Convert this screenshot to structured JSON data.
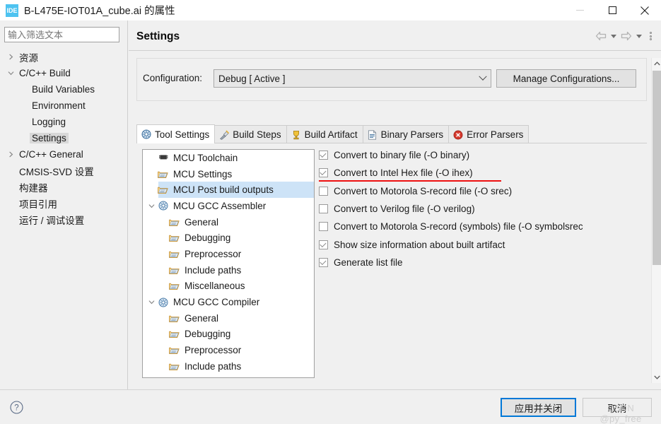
{
  "window": {
    "title": "B-L475E-IOT01A_cube.ai 的属性",
    "app_icon_text": "IDE",
    "controls": [
      {
        "name": "minimize",
        "glyph": "minimize-icon"
      },
      {
        "name": "maximize",
        "glyph": "maximize-icon"
      },
      {
        "name": "close",
        "glyph": "close-icon"
      }
    ]
  },
  "sidebar": {
    "filter_placeholder": "输入筛选文本",
    "filter_value": "",
    "items": [
      {
        "label": "资源",
        "indent": 0,
        "arrow": "right",
        "selected": false
      },
      {
        "label": "C/C++ Build",
        "indent": 0,
        "arrow": "down",
        "selected": false
      },
      {
        "label": "Build Variables",
        "indent": 1,
        "arrow": "none",
        "selected": false
      },
      {
        "label": "Environment",
        "indent": 1,
        "arrow": "none",
        "selected": false
      },
      {
        "label": "Logging",
        "indent": 1,
        "arrow": "none",
        "selected": false
      },
      {
        "label": "Settings",
        "indent": 1,
        "arrow": "none",
        "selected": true
      },
      {
        "label": "C/C++ General",
        "indent": 0,
        "arrow": "right",
        "selected": false
      },
      {
        "label": "CMSIS-SVD 设置",
        "indent": 0,
        "arrow": "none",
        "selected": false
      },
      {
        "label": "构建器",
        "indent": 0,
        "arrow": "none",
        "selected": false
      },
      {
        "label": "项目引用",
        "indent": 0,
        "arrow": "none",
        "selected": false
      },
      {
        "label": "运行 / 调试设置",
        "indent": 0,
        "arrow": "none",
        "selected": false
      }
    ]
  },
  "main": {
    "page_title": "Settings",
    "nav": {
      "back_icon": "back-arrow-icon",
      "back_dropdown_icon": "chevron-down-icon",
      "forward_icon": "forward-arrow-icon",
      "forward_dropdown_icon": "chevron-down-icon",
      "menu_icon": "vertical-dots-icon"
    },
    "configuration": {
      "label": "Configuration:",
      "selected": "Debug  [ Active ]",
      "manage_button": "Manage Configurations..."
    },
    "tabs": [
      {
        "label": "Tool Settings",
        "icon": "tool-settings-icon",
        "active": true
      },
      {
        "label": "Build Steps",
        "icon": "build-steps-icon",
        "active": false
      },
      {
        "label": "Build Artifact",
        "icon": "build-artifact-icon",
        "active": false
      },
      {
        "label": "Binary Parsers",
        "icon": "binary-parsers-icon",
        "active": false
      },
      {
        "label": "Error Parsers",
        "icon": "error-parsers-icon",
        "active": false
      }
    ],
    "option_tree": [
      {
        "label": "MCU Toolchain",
        "indent": 1,
        "arrow": "none",
        "icon": "chip-icon",
        "selected": false
      },
      {
        "label": "MCU Settings",
        "indent": 1,
        "arrow": "none",
        "icon": "folder-icon",
        "selected": false
      },
      {
        "label": "MCU Post build outputs",
        "indent": 1,
        "arrow": "none",
        "icon": "folder-icon",
        "selected": true
      },
      {
        "label": "MCU GCC Assembler",
        "indent": 0,
        "arrow": "down",
        "icon": "gear-icon",
        "selected": false
      },
      {
        "label": "General",
        "indent": 2,
        "arrow": "none",
        "icon": "folder-icon",
        "selected": false
      },
      {
        "label": "Debugging",
        "indent": 2,
        "arrow": "none",
        "icon": "folder-icon",
        "selected": false
      },
      {
        "label": "Preprocessor",
        "indent": 2,
        "arrow": "none",
        "icon": "folder-icon",
        "selected": false
      },
      {
        "label": "Include paths",
        "indent": 2,
        "arrow": "none",
        "icon": "folder-icon",
        "selected": false
      },
      {
        "label": "Miscellaneous",
        "indent": 2,
        "arrow": "none",
        "icon": "folder-icon",
        "selected": false
      },
      {
        "label": "MCU GCC Compiler",
        "indent": 0,
        "arrow": "down",
        "icon": "gear-icon",
        "selected": false
      },
      {
        "label": "General",
        "indent": 2,
        "arrow": "none",
        "icon": "folder-icon",
        "selected": false
      },
      {
        "label": "Debugging",
        "indent": 2,
        "arrow": "none",
        "icon": "folder-icon",
        "selected": false
      },
      {
        "label": "Preprocessor",
        "indent": 2,
        "arrow": "none",
        "icon": "folder-icon",
        "selected": false
      },
      {
        "label": "Include paths",
        "indent": 2,
        "arrow": "none",
        "icon": "folder-icon",
        "selected": false
      }
    ],
    "checkboxes": [
      {
        "label": "Convert to binary file (-O binary)",
        "checked": true,
        "underlined": false
      },
      {
        "label": "Convert to Intel Hex file (-O ihex)",
        "checked": true,
        "underlined": true
      },
      {
        "label": "Convert to Motorola S-record file (-O srec)",
        "checked": false,
        "underlined": false
      },
      {
        "label": "Convert to Verilog file (-O verilog)",
        "checked": false,
        "underlined": false
      },
      {
        "label": "Convert to Motorola S-record (symbols) file (-O symbolsrec",
        "checked": false,
        "underlined": false
      },
      {
        "label": "Show size information about built artifact",
        "checked": true,
        "underlined": false
      },
      {
        "label": "Generate list file",
        "checked": true,
        "underlined": false
      }
    ],
    "scrollbar": {
      "up_icon": "scroll-up-icon",
      "down_icon": "scroll-down-icon"
    }
  },
  "footer": {
    "help_icon": "help-icon",
    "apply_button": "应用并关闭",
    "cancel_button": "取消",
    "watermark": "CSDN @py_free"
  },
  "colors": {
    "accent": "#0078d7",
    "selection": "#cde3f7",
    "underline": "#ee1111",
    "app_icon_bg": "#4ec3f0"
  }
}
